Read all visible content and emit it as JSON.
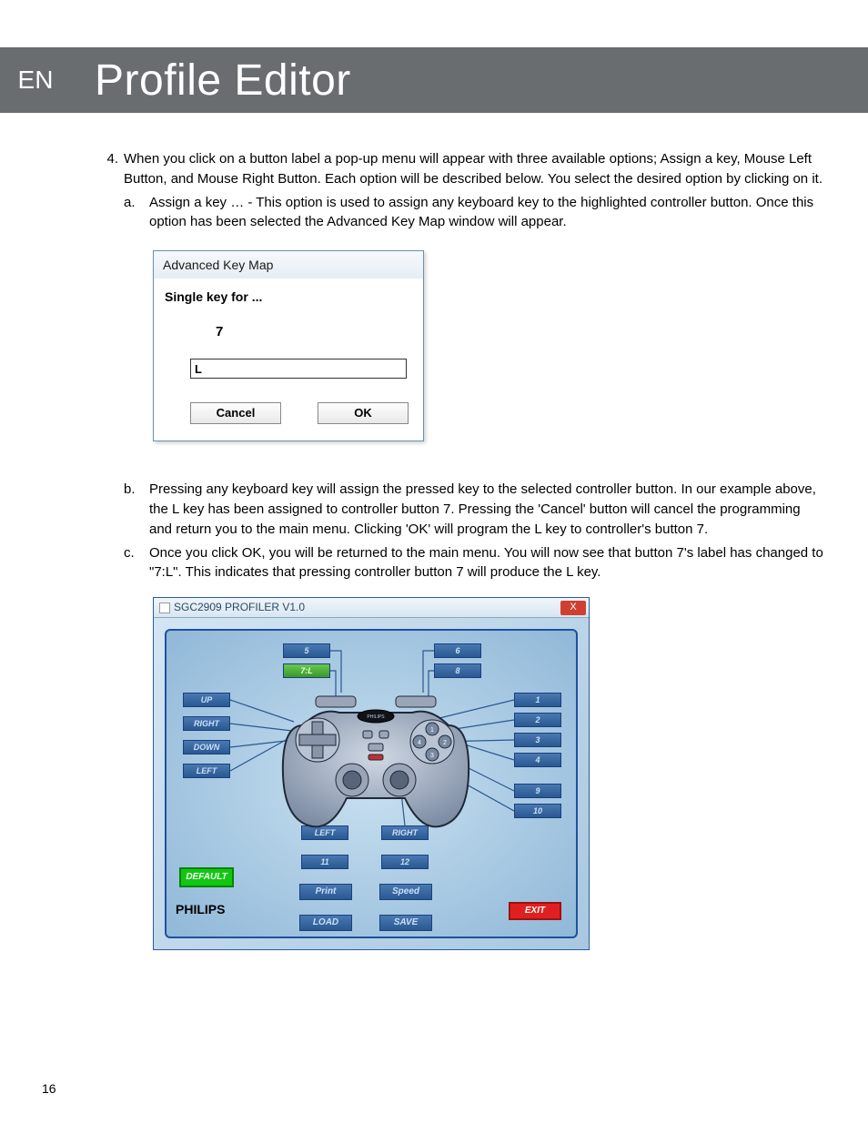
{
  "header": {
    "lang": "EN",
    "title": "Profile Editor"
  },
  "step4": {
    "num": "4.",
    "text": "When you click on a button label a pop-up menu will appear with three available options; Assign a key, Mouse Left Button, and Mouse Right Button. Each option will be described below. You select the desired option by clicking on it.",
    "a_let": "a.",
    "a_text": "Assign a key … - This option is used to assign any keyboard key to the highlighted controller button. Once this option has been selected the Advanced Key Map window will appear."
  },
  "dialog1": {
    "title": "Advanced Key Map",
    "label": "Single key for ...",
    "seven": "7",
    "value": "L",
    "cancel": "Cancel",
    "ok": "OK"
  },
  "below": {
    "b_let": "b.",
    "b_text": "Pressing any keyboard key will assign the pressed key to the selected controller button. In our example above, the L key has been assigned to controller button 7. Pressing the 'Cancel' button will cancel the programming and return you to the main menu. Clicking 'OK' will program the L key to controller's button 7.",
    "c_let": "c.",
    "c_text": "Once you click OK, you will be returned to the main menu. You will now see that button 7's label has changed to \"7:L\". This indicates that pressing controller button 7 will produce the L key."
  },
  "window2": {
    "title": "SGC2909 PROFILER V1.0",
    "close": "X",
    "top_l1": "5",
    "top_r1": "6",
    "top_l2": "7:L",
    "top_r2": "8",
    "dpad_up": "UP",
    "dpad_right": "RIGHT",
    "dpad_down": "DOWN",
    "dpad_left": "LEFT",
    "r1": "1",
    "r2": "2",
    "r3": "3",
    "r4": "4",
    "r9": "9",
    "r10": "10",
    "stick_l": "LEFT",
    "stick_r": "RIGHT",
    "b11": "11",
    "b12": "12",
    "print": "Print",
    "speed": "Speed",
    "load": "LOAD",
    "save": "SAVE",
    "default": "DEFAULT",
    "exit": "EXIT",
    "logo": "PHILIPS"
  },
  "page_num": "16"
}
